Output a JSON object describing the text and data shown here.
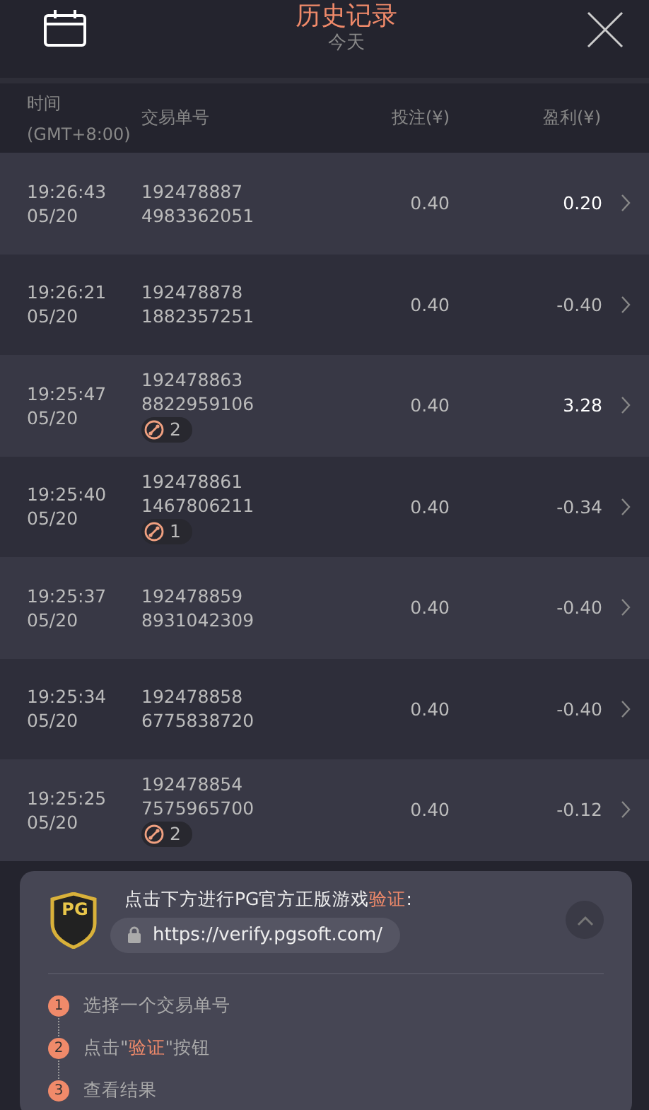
{
  "header": {
    "title": "历史记录",
    "subtitle": "今天"
  },
  "columns": {
    "time": "时间",
    "timezone": "(GMT+8:00)",
    "order": "交易单号",
    "bet": "投注(¥)",
    "profit": "盈利(¥)"
  },
  "rows": [
    {
      "time": "19:26:43",
      "date": "05/20",
      "order_a": "192478887",
      "order_b": "4983362051",
      "bet": "0.40",
      "profit": "0.20",
      "win": true
    },
    {
      "time": "19:26:21",
      "date": "05/20",
      "order_a": "192478878",
      "order_b": "1882357251",
      "bet": "0.40",
      "profit": "-0.40",
      "win": false
    },
    {
      "time": "19:25:47",
      "date": "05/20",
      "order_a": "192478863",
      "order_b": "8822959106",
      "free_spins": "2",
      "bet": "0.40",
      "profit": "3.28",
      "win": true
    },
    {
      "time": "19:25:40",
      "date": "05/20",
      "order_a": "192478861",
      "order_b": "1467806211",
      "free_spins": "1",
      "bet": "0.40",
      "profit": "-0.34",
      "win": false
    },
    {
      "time": "19:25:37",
      "date": "05/20",
      "order_a": "192478859",
      "order_b": "8931042309",
      "bet": "0.40",
      "profit": "-0.40",
      "win": false
    },
    {
      "time": "19:25:34",
      "date": "05/20",
      "order_a": "192478858",
      "order_b": "6775838720",
      "bet": "0.40",
      "profit": "-0.40",
      "win": false
    },
    {
      "time": "19:25:25",
      "date": "05/20",
      "order_a": "192478854",
      "order_b": "7575965700",
      "free_spins": "2",
      "bet": "0.40",
      "profit": "-0.12",
      "win": false
    }
  ],
  "verify_panel": {
    "badge": "PG",
    "message": "点击下方进行PG官方正版游戏**验证**:",
    "url": "https://verify.pgsoft.com/",
    "steps": [
      {
        "number": "1",
        "text": "选择一个交易单号"
      },
      {
        "number": "2",
        "text": "点击\"**验证**\"按钮"
      },
      {
        "number": "3",
        "text": "查看结果"
      }
    ]
  }
}
